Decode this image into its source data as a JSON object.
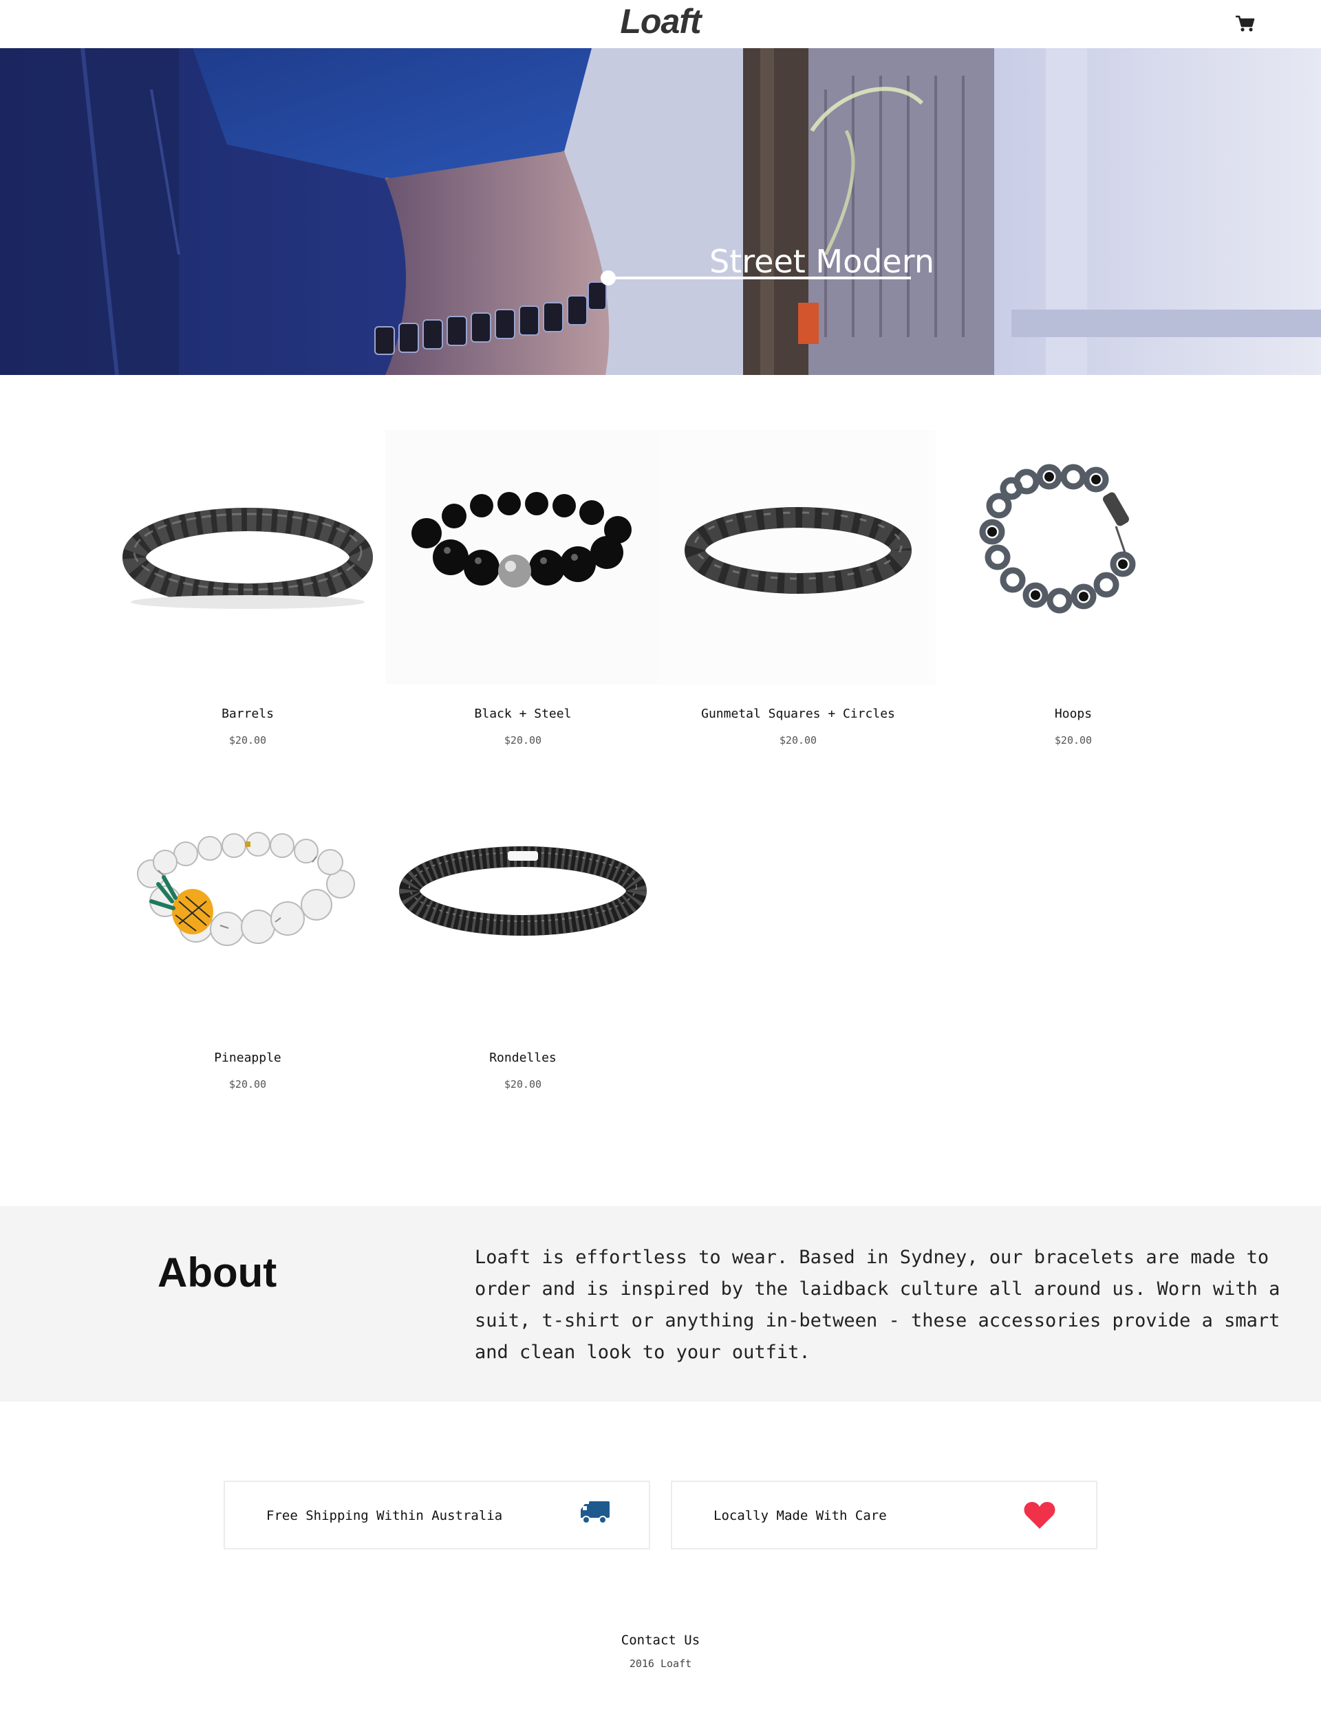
{
  "header": {
    "logo": "Loaft",
    "cart_icon": "cart-icon"
  },
  "hero": {
    "title": "Street Modern"
  },
  "products": [
    {
      "name": "Barrels",
      "price": "$20.00"
    },
    {
      "name": "Black + Steel",
      "price": "$20.00"
    },
    {
      "name": "Gunmetal Squares + Circles",
      "price": "$20.00"
    },
    {
      "name": "Hoops",
      "price": "$20.00"
    },
    {
      "name": "Pineapple",
      "price": "$20.00"
    },
    {
      "name": "Rondelles",
      "price": "$20.00"
    }
  ],
  "about": {
    "heading": "About",
    "body": "Loaft is effortless to wear. Based in Sydney, our bracelets are made to order and is inspired by the laidback culture all around us. Worn with a suit, t-shirt or anything in-between - these accessories provide a smart and clean look to your outfit."
  },
  "features": [
    {
      "text": "Free Shipping Within Australia",
      "icon": "truck-icon",
      "color": "#1f5a8f"
    },
    {
      "text": "Locally Made With Care",
      "icon": "heart-icon",
      "color": "#f0314a"
    }
  ],
  "footer": {
    "contact": "Contact Us",
    "copyright": "2016 Loaft"
  }
}
